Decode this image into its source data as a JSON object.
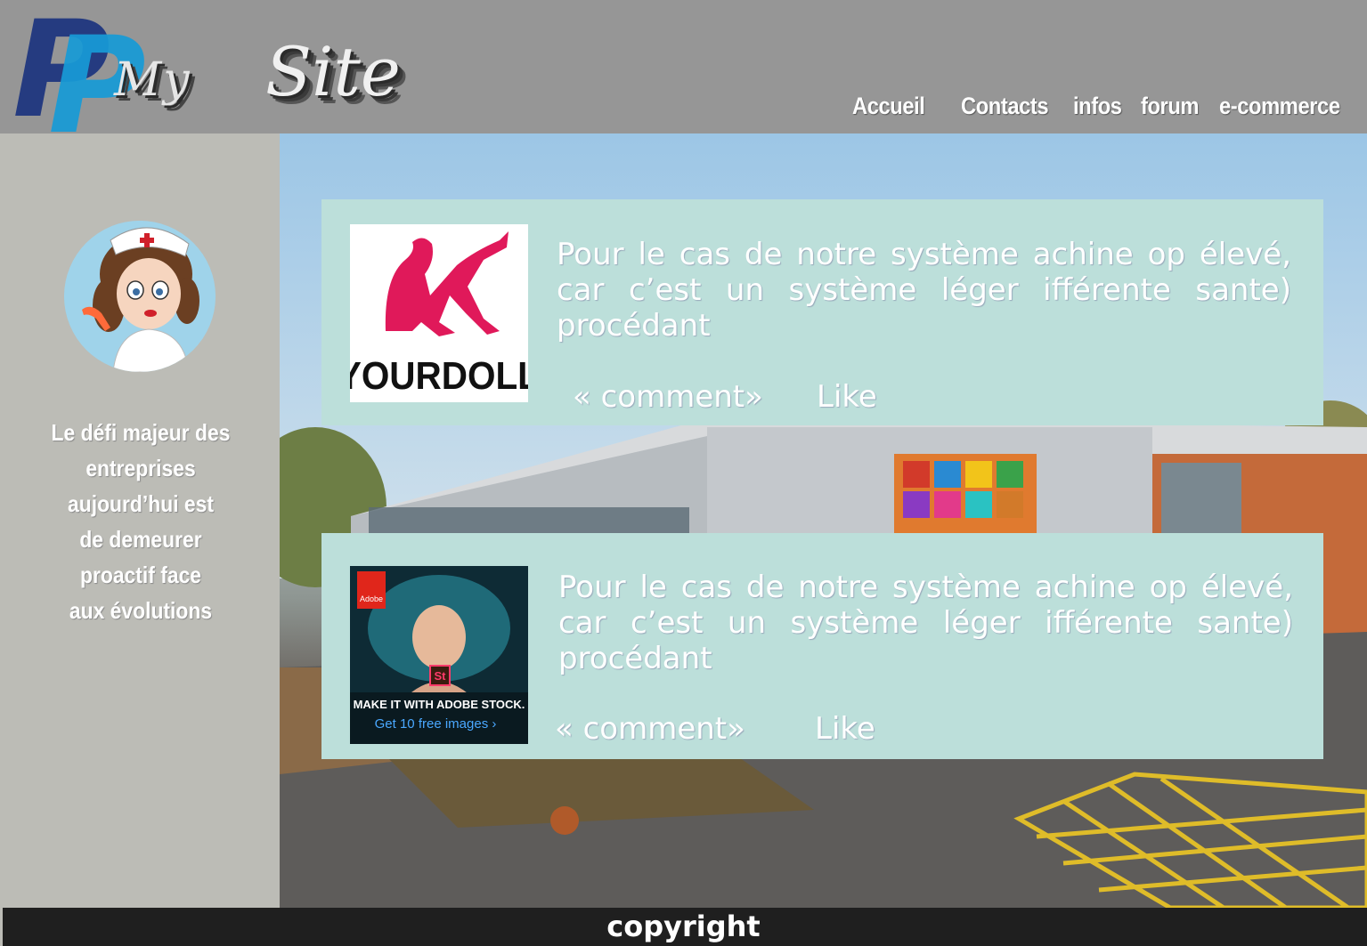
{
  "header": {
    "logo_letters": "P",
    "logo_my": "My",
    "logo_site": "Site",
    "nav": [
      "Accueil",
      "Contacts",
      "infos",
      "forum",
      "e-commerce"
    ]
  },
  "sidebar": {
    "text_lines": [
      "Le défi majeur des",
      "entreprises",
      "aujourd’hui est",
      "de demeurer",
      "proactif face",
      "aux évolutions"
    ]
  },
  "posts": [
    {
      "ad_brand": "YOURDOLL",
      "text": "Pour le cas de notre système achine op élevé, car c’est un système léger ifférente sante) procédant",
      "comment": "« comment»",
      "like": "Like"
    },
    {
      "ad_brand": "Adobe",
      "ad_st": "St",
      "ad_line1": "MAKE IT WITH ADOBE STOCK.",
      "ad_line2": "Get 10 free images ›",
      "text": "Pour le cas de notre système achine op élevé, car c’est un système léger ifférente sante) procédant",
      "comment": "« comment»",
      "like": "Like"
    }
  ],
  "footer": {
    "copyright": "copyright"
  },
  "colors": {
    "header": "#969696",
    "sidebar": "#bcbcb6",
    "card": "#bcdfda",
    "footer": "#1f1f1f"
  }
}
